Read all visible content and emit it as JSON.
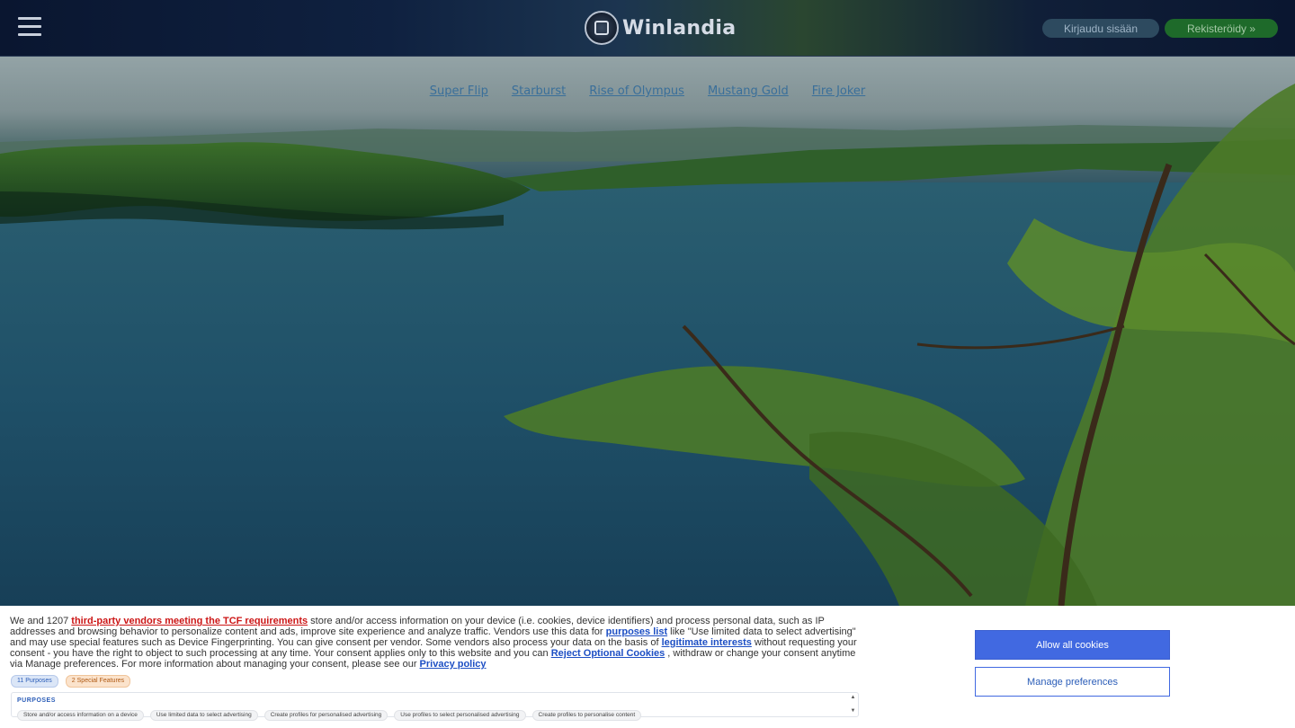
{
  "header": {
    "logo_text": "Winlandia",
    "login_label": "Kirjaudu sisään",
    "register_label": "Rekisteröidy »"
  },
  "game_links": [
    "Super Flip",
    "Starburst",
    "Rise of Olympus",
    "Mustang Gold",
    "Fire Joker"
  ],
  "cookie": {
    "text_1": "We and 1207 ",
    "link_vendors": "third-party vendors meeting the TCF requirements",
    "text_2": " store and/or access information on your device (i.e. cookies, device identifiers) and process personal data, such as IP addresses and browsing behavior to personalize content and ads, improve site experience and analyze traffic. Vendors use this data for ",
    "link_purposes": "purposes list",
    "text_3": "  like \"Use limited data to select advertising\" and may use special features such as Device Fingerprinting. You can give consent per vendor. Some vendors also process your data on the basis of ",
    "link_legit": "legitimate interests",
    "text_4": "  without requesting your consent - you have the right to object to such processing at any time. Your consent applies only to this website and you can ",
    "link_reject": "Reject Optional Cookies",
    "text_5": " , withdraw or change your consent anytime via Manage preferences. For more information about managing your consent, please see our ",
    "link_privacy": "Privacy policy",
    "chip_purposes": "11 Purposes",
    "chip_features": "2 Special Features",
    "purposes_title": "PURPOSES",
    "purpose_items": [
      "Store and/or access information on a device",
      "Use limited data to select advertising",
      "Create profiles for personalised advertising",
      "Use profiles to select personalised advertising",
      "Create profiles to personalise content"
    ],
    "allow_label": "Allow all cookies",
    "manage_label": "Manage preferences"
  },
  "icons": [
    "hamburger-menu-icon",
    "winlandia-logo-icon",
    "scroll-up-icon",
    "scroll-down-icon"
  ],
  "colors": {
    "header_bg": "#0a1630",
    "register_green": "#1e6a2a",
    "login_blue": "#2d4a5f",
    "link_blue": "#3a6f9a",
    "allow_button": "#4169e1"
  }
}
